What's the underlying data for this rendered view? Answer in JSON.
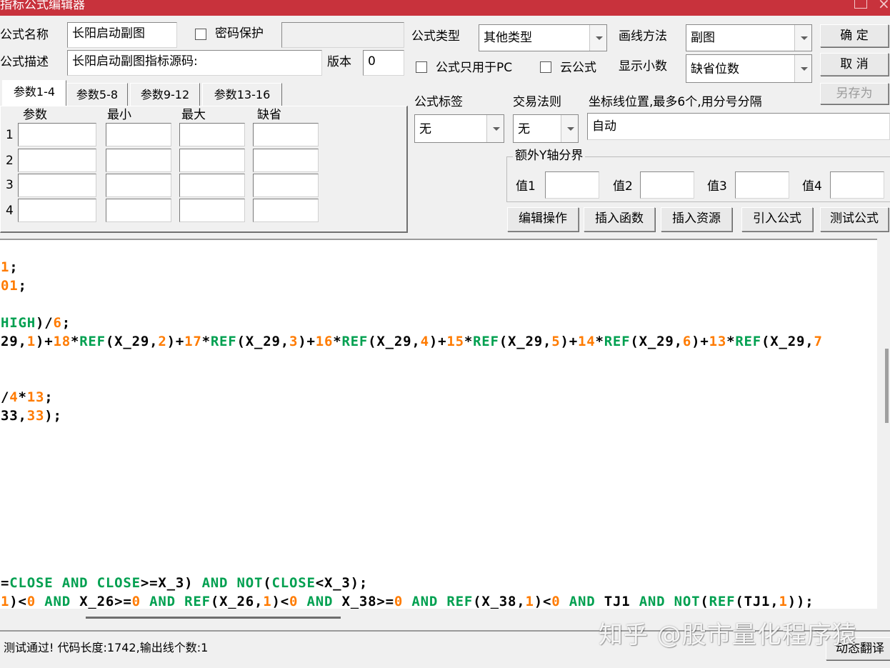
{
  "window": {
    "title": "指标公式编辑器"
  },
  "form": {
    "name_label": "公式名称",
    "name_value": "长阳启动副图",
    "password_label": "密码保护",
    "desc_label": "公式描述",
    "desc_value": "长阳启动副图指标源码:",
    "version_label": "版本",
    "version_value": "0",
    "type_label": "公式类型",
    "type_value": "其他类型",
    "draw_label": "画线方法",
    "draw_value": "副图",
    "pc_only_label": "公式只用于PC",
    "cloud_label": "云公式",
    "decimals_label": "显示小数",
    "decimals_value": "缺省位数",
    "tag_label": "公式标签",
    "tag_value": "无",
    "trade_label": "交易法则",
    "trade_value": "无",
    "axis_label": "坐标线位置,最多6个,用分号分隔",
    "axis_value": "自动",
    "extra_y_label": "额外Y轴分界",
    "val1": "值1",
    "val2": "值2",
    "val3": "值3",
    "val4": "值4"
  },
  "buttons": {
    "ok": "确 定",
    "cancel": "取 消",
    "save_as": "另存为",
    "edit_ops": "编辑操作",
    "insert_func": "插入函数",
    "insert_res": "插入资源",
    "import": "引入公式",
    "test": "测试公式"
  },
  "tabs": [
    "参数1-4",
    "参数5-8",
    "参数9-12",
    "参数13-16"
  ],
  "params": {
    "headers": [
      "参数",
      "最小",
      "最大",
      "缺省"
    ],
    "rows": [
      "1",
      "2",
      "3",
      "4"
    ]
  },
  "code_lines": [
    [
      [
        "n",
        "1"
      ],
      [
        "t",
        ";"
      ]
    ],
    [
      [
        "n",
        "01"
      ],
      [
        "t",
        ";"
      ]
    ],
    [],
    [
      [
        "k",
        "HIGH"
      ],
      [
        "t",
        ")/"
      ],
      [
        "n",
        "6"
      ],
      [
        "t",
        ";"
      ]
    ],
    [
      [
        "t",
        "29,"
      ],
      [
        "n",
        "1"
      ],
      [
        "t",
        ")+"
      ],
      [
        "n",
        "18"
      ],
      [
        "t",
        "*"
      ],
      [
        "k",
        "REF"
      ],
      [
        "t",
        "(X_29,"
      ],
      [
        "n",
        "2"
      ],
      [
        "t",
        ")+"
      ],
      [
        "n",
        "17"
      ],
      [
        "t",
        "*"
      ],
      [
        "k",
        "REF"
      ],
      [
        "t",
        "(X_29,"
      ],
      [
        "n",
        "3"
      ],
      [
        "t",
        ")+"
      ],
      [
        "n",
        "16"
      ],
      [
        "t",
        "*"
      ],
      [
        "k",
        "REF"
      ],
      [
        "t",
        "(X_29,"
      ],
      [
        "n",
        "4"
      ],
      [
        "t",
        ")+"
      ],
      [
        "n",
        "15"
      ],
      [
        "t",
        "*"
      ],
      [
        "k",
        "REF"
      ],
      [
        "t",
        "(X_29,"
      ],
      [
        "n",
        "5"
      ],
      [
        "t",
        ")+"
      ],
      [
        "n",
        "14"
      ],
      [
        "t",
        "*"
      ],
      [
        "k",
        "REF"
      ],
      [
        "t",
        "(X_29,"
      ],
      [
        "n",
        "6"
      ],
      [
        "t",
        ")+"
      ],
      [
        "n",
        "13"
      ],
      [
        "t",
        "*"
      ],
      [
        "k",
        "REF"
      ],
      [
        "t",
        "(X_29,"
      ],
      [
        "n",
        "7"
      ]
    ],
    [],
    [],
    [
      [
        "t",
        "/"
      ],
      [
        "n",
        "4"
      ],
      [
        "t",
        "*"
      ],
      [
        "n",
        "13"
      ],
      [
        "t",
        ";"
      ]
    ],
    [
      [
        "t",
        "33,"
      ],
      [
        "n",
        "33"
      ],
      [
        "t",
        ");"
      ]
    ],
    [],
    [],
    [],
    [],
    [],
    [],
    [],
    [],
    [
      [
        "t",
        "="
      ],
      [
        "k",
        "CLOSE"
      ],
      [
        "t",
        " "
      ],
      [
        "k",
        "AND"
      ],
      [
        "t",
        " "
      ],
      [
        "k",
        "CLOSE"
      ],
      [
        "t",
        ">=X_3) "
      ],
      [
        "k",
        "AND"
      ],
      [
        "t",
        " "
      ],
      [
        "k",
        "NOT"
      ],
      [
        "t",
        "("
      ],
      [
        "k",
        "CLOSE"
      ],
      [
        "t",
        "<X_3);"
      ]
    ],
    [
      [
        "n",
        "1"
      ],
      [
        "t",
        ")<"
      ],
      [
        "n",
        "0"
      ],
      [
        "t",
        " "
      ],
      [
        "k",
        "AND"
      ],
      [
        "t",
        " X_26>="
      ],
      [
        "n",
        "0"
      ],
      [
        "t",
        " "
      ],
      [
        "k",
        "AND"
      ],
      [
        "t",
        " "
      ],
      [
        "k",
        "REF"
      ],
      [
        "t",
        "(X_26,"
      ],
      [
        "n",
        "1"
      ],
      [
        "t",
        ")<"
      ],
      [
        "n",
        "0"
      ],
      [
        "t",
        " "
      ],
      [
        "k",
        "AND"
      ],
      [
        "t",
        " X_38>="
      ],
      [
        "n",
        "0"
      ],
      [
        "t",
        " "
      ],
      [
        "k",
        "AND"
      ],
      [
        "t",
        " "
      ],
      [
        "k",
        "REF"
      ],
      [
        "t",
        "(X_38,"
      ],
      [
        "n",
        "1"
      ],
      [
        "t",
        ")<"
      ],
      [
        "n",
        "0"
      ],
      [
        "t",
        " "
      ],
      [
        "k",
        "AND"
      ],
      [
        "t",
        " TJ1 "
      ],
      [
        "k",
        "AND"
      ],
      [
        "t",
        " "
      ],
      [
        "k",
        "NOT"
      ],
      [
        "t",
        "("
      ],
      [
        "k",
        "REF"
      ],
      [
        "t",
        "(TJ1,"
      ],
      [
        "n",
        "1"
      ],
      [
        "t",
        "));"
      ]
    ]
  ],
  "status": {
    "message": "测试通过! 代码长度:1742,输出线个数:1",
    "translate_button": "动态翻译"
  },
  "watermark": "知乎 @股市量化程序猿",
  "colors": {
    "title_bar": "#c8323c",
    "number": "#ff7b00",
    "keyword": "#00a050"
  }
}
